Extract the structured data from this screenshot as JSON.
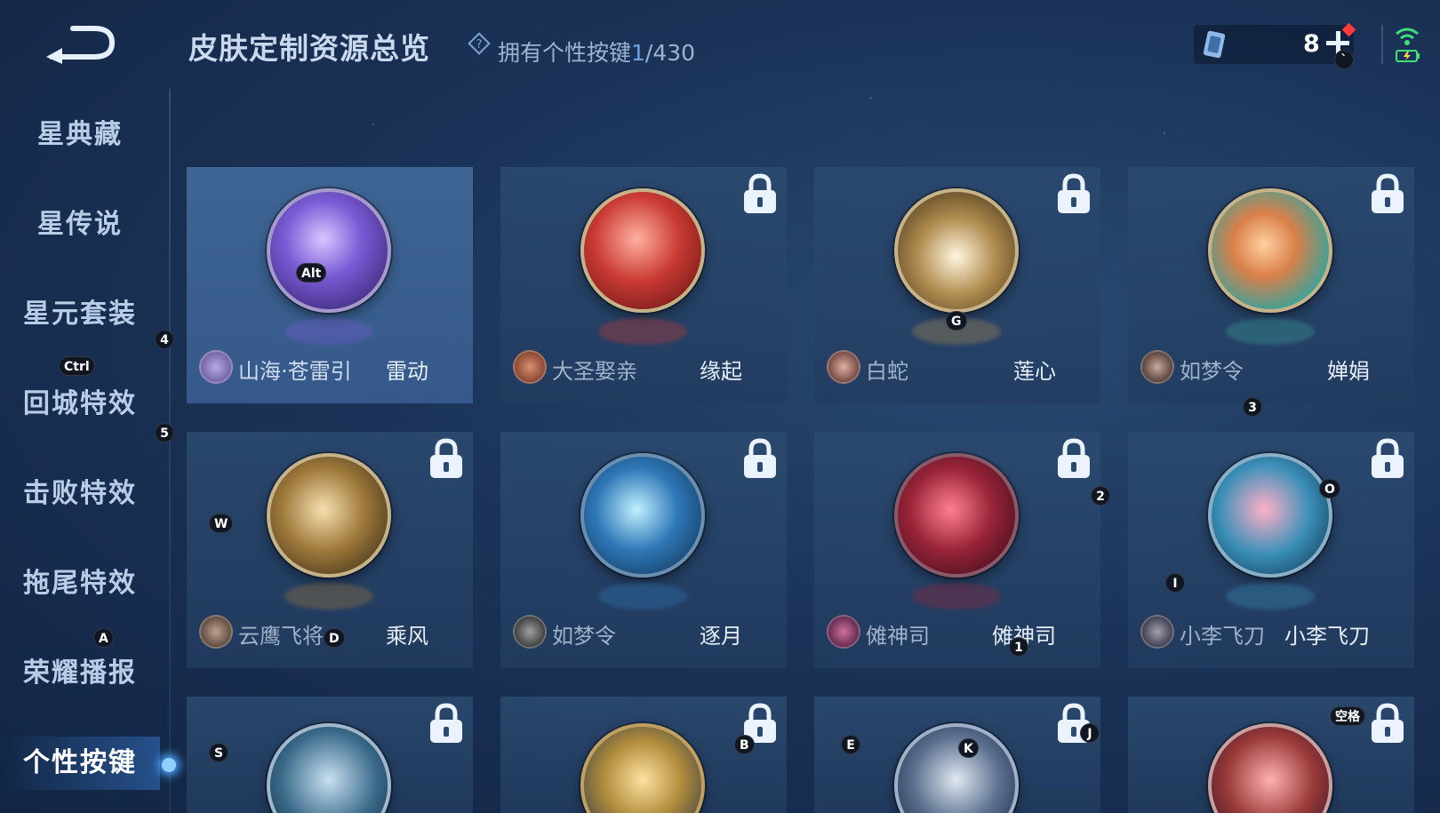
{
  "header": {
    "title": "皮肤定制资源总览",
    "help_icon": "question-icon",
    "owned_label": "拥有个性按键",
    "owned_count": "1",
    "owned_total": "/430",
    "currency_value": "8",
    "add_icon": "plus-icon"
  },
  "sidebar": {
    "items": [
      {
        "label": "星典藏"
      },
      {
        "label": "星传说"
      },
      {
        "label": "星元套装"
      },
      {
        "label": "回城特效"
      },
      {
        "label": "击败特效"
      },
      {
        "label": "拖尾特效"
      },
      {
        "label": "荣耀播报"
      },
      {
        "label": "个性按键",
        "active": true
      }
    ]
  },
  "key_badges": [
    "Alt",
    "4",
    "Ctrl",
    "5",
    "G",
    "3",
    "W",
    "D",
    "2",
    "O",
    "I",
    "A",
    "1",
    "S",
    "B",
    "E",
    "K",
    "J",
    "空格"
  ],
  "cards": [
    {
      "hero": "山海·苍雷引",
      "skin": "雷动",
      "locked": false,
      "selected": true,
      "color": "#7a5bd6"
    },
    {
      "hero": "大圣娶亲",
      "skin": "缘起",
      "locked": true,
      "color": "#c93a33"
    },
    {
      "hero": "白蛇",
      "skin": "莲心",
      "locked": true,
      "color": "#b08c4f"
    },
    {
      "hero": "如梦令",
      "skin": "婵娟",
      "locked": true,
      "color": "#3aa39a"
    },
    {
      "hero": "云鹰飞将",
      "skin": "乘风",
      "locked": true,
      "color": "#a07a3c"
    },
    {
      "hero": "如梦令",
      "skin": "逐月",
      "locked": true,
      "color": "#2f78b8"
    },
    {
      "hero": "傩神司",
      "skin": "傩神司",
      "locked": true,
      "color": "#9a2438"
    },
    {
      "hero": "小李飞刀",
      "skin": "小李飞刀",
      "locked": true,
      "color": "#3a8fb8"
    },
    {
      "hero": "",
      "skin": "",
      "locked": true,
      "color": "#3a6a8a"
    },
    {
      "hero": "",
      "skin": "",
      "locked": false,
      "color": "#b08c3c"
    },
    {
      "hero": "",
      "skin": "",
      "locked": true,
      "color": "#5a6f8e"
    },
    {
      "hero": "",
      "skin": "",
      "locked": true,
      "color": "#9a3a3a"
    }
  ]
}
